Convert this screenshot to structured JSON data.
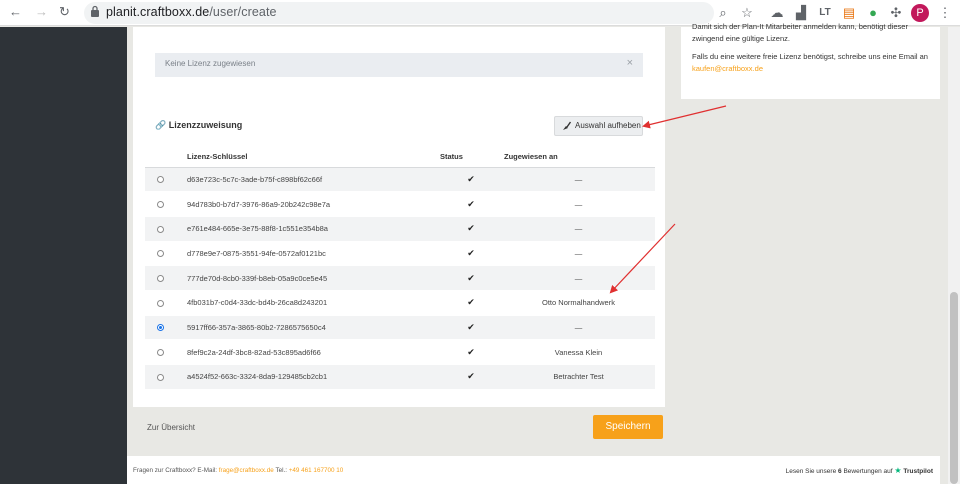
{
  "browser": {
    "url_domain": "planit.craftboxx.de",
    "url_path": "/user/create",
    "avatar_letter": "P"
  },
  "license_box": {
    "empty_text": "Keine Lizenz zugewiesen",
    "clear_icon": "close-icon"
  },
  "assignment": {
    "title": "Lizenzzuweisung",
    "clear_button": "Auswahl aufheben",
    "columns": {
      "key": "Lizenz-Schlüssel",
      "status": "Status",
      "assigned": "Zugewiesen an"
    },
    "rows": [
      {
        "key": "d63e723c-5c7c-3ade-b75f-c898bf62c66f",
        "status": "✔",
        "assigned": "—",
        "selected": false
      },
      {
        "key": "94d783b0-b7d7-3976-86a9-20b242c98e7a",
        "status": "✔",
        "assigned": "—",
        "selected": false
      },
      {
        "key": "e761e484-665e-3e75-88f8-1c551e354b8a",
        "status": "✔",
        "assigned": "—",
        "selected": false
      },
      {
        "key": "d778e9e7-0875-3551-94fe-0572af0121bc",
        "status": "✔",
        "assigned": "—",
        "selected": false
      },
      {
        "key": "777de70d-8cb0-339f-b8eb-05a9c0ce5e45",
        "status": "✔",
        "assigned": "—",
        "selected": false
      },
      {
        "key": "4fb031b7-c0d4-33dc-bd4b-26ca8d243201",
        "status": "✔",
        "assigned": "Otto Normalhandwerk",
        "selected": false
      },
      {
        "key": "5917ff66-357a-3865-80b2-7286575650c4",
        "status": "✔",
        "assigned": "—",
        "selected": true
      },
      {
        "key": "8fef9c2a-24df-3bc8-82ad-53c895ad6f66",
        "status": "✔",
        "assigned": "Vanessa Klein",
        "selected": false
      },
      {
        "key": "a4524f52-663c-3324-8da9-129485cb2cb1",
        "status": "✔",
        "assigned": "Betrachter Test",
        "selected": false
      }
    ]
  },
  "actions": {
    "back": "Zur Übersicht",
    "save": "Speichern"
  },
  "info": {
    "clipped_line": "Damit sich der Plan-It Mitarbeiter anmelden kann, benötigt dieser",
    "line2": "zwingend eine gültige Lizenz.",
    "line3": "Falls du eine weitere freie Lizenz benötigst, schreibe uns eine Email an",
    "email": "kaufen@craftboxx.de"
  },
  "footer": {
    "question": "Fragen zur Craftboxx?",
    "email_label": "E-Mail:",
    "email": "frage@craftboxx.de",
    "phone_label": "Tel.:",
    "phone": "+49 461 167700 10",
    "reviews_prefix": "Lesen Sie unsere",
    "reviews_count": "6",
    "reviews_suffix": "Bewertungen auf",
    "trustpilot": "Trustpilot"
  },
  "colors": {
    "accent": "#f7a11a",
    "sidebar": "#2e3338",
    "annotation_arrow": "#e03030"
  }
}
